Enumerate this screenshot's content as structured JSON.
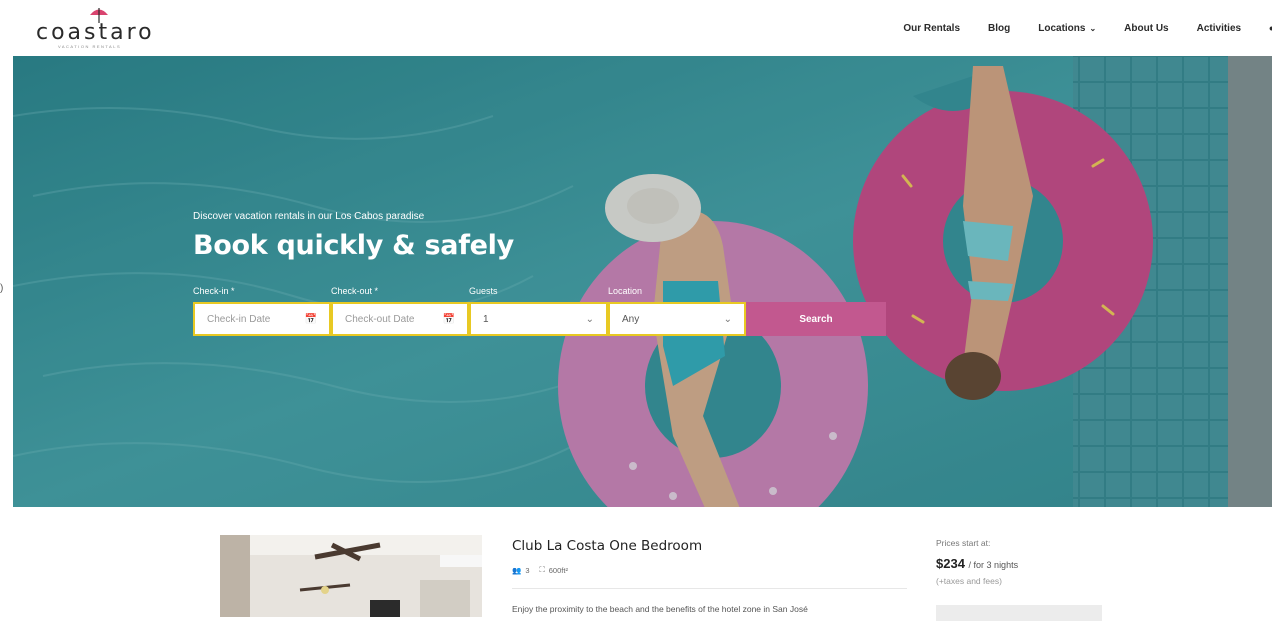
{
  "brand": {
    "logo_text": "coastaro",
    "logo_subtext": "VACATION RENTALS"
  },
  "nav": {
    "items": [
      {
        "label": "Our Rentals"
      },
      {
        "label": "Blog"
      },
      {
        "label": "Locations"
      },
      {
        "label": "About Us"
      },
      {
        "label": "Activities"
      }
    ],
    "more": "•"
  },
  "hero": {
    "subtitle": "Discover vacation rentals in our Los Cabos paradise",
    "title": "Book quickly & safely"
  },
  "search": {
    "checkin_label": "Check-in",
    "checkin_placeholder": "Check-in Date",
    "checkout_label": "Check-out",
    "checkout_placeholder": "Check-out Date",
    "required_mark": "*",
    "guests_label": "Guests",
    "guests_value": "1",
    "location_label": "Location",
    "location_value": "Any",
    "button_label": "Search"
  },
  "listing": {
    "title": "Club La Costa One Bedroom",
    "guests": "3",
    "area": "600ft²",
    "description": "Enjoy the proximity to the beach and the benefits of the hotel zone in San José",
    "price_intro": "Prices start at:",
    "price": "$234",
    "price_suffix": "/ for 3 nights",
    "fees_note": "(+taxes and fees)"
  },
  "colors": {
    "accent": "#c2588f",
    "field_border": "#e8c923",
    "water": "#3f9ea3"
  },
  "icons": {
    "calendar": "calendar-icon",
    "chevron": "chevron-down-icon",
    "guests": "guests-icon",
    "area": "area-icon"
  }
}
